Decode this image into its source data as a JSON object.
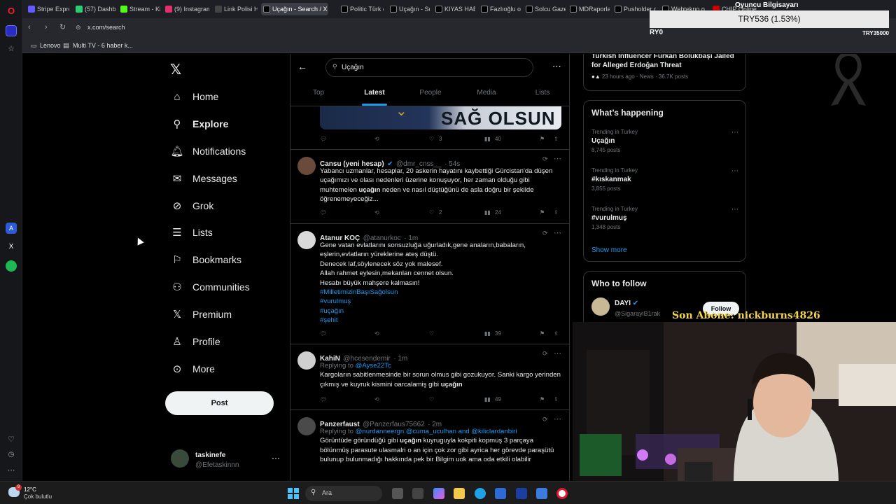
{
  "browser": {
    "tabs": [
      {
        "label": "Stripe Expres",
        "color": "#635bff"
      },
      {
        "label": "(57) Dashbo",
        "color": "#2ecc71"
      },
      {
        "label": "Stream - Kick",
        "color": "#53fc18"
      },
      {
        "label": "(9) Instagram",
        "color": "#e1306c"
      },
      {
        "label": "Link Polisi H",
        "color": "#444"
      },
      {
        "label": "Uçağın - Search / X",
        "color": "#000"
      },
      {
        "label": "Politic Türk o",
        "color": "#000"
      },
      {
        "label": "Uçağın - Sea",
        "color": "#000"
      },
      {
        "label": "KIYAS HABER",
        "color": "#000"
      },
      {
        "label": "Fazlıoğlu on",
        "color": "#000"
      },
      {
        "label": "Solcu Gazete",
        "color": "#000"
      },
      {
        "label": "MDRaporlar",
        "color": "#000"
      },
      {
        "label": "Pusholder o",
        "color": "#000"
      },
      {
        "label": "Webtekno o",
        "color": "#000"
      },
      {
        "label": "CHIP Online",
        "color": "#c00"
      }
    ],
    "url": "x.com/search",
    "bookmarks": [
      "Lenovo",
      "Multi TV - 6 haber k..."
    ]
  },
  "overlay": {
    "stream_title": "Oyuncu Bilgisayarı",
    "donation": "TRY536 (1.53%)",
    "left_amount": "RY0",
    "right_amount": "TRY35000",
    "last_sub": "Son Abone: nickburns4826"
  },
  "sidebar": {
    "items": [
      {
        "label": "Home",
        "icon": "home-icon"
      },
      {
        "label": "Explore",
        "icon": "search-icon"
      },
      {
        "label": "Notifications",
        "icon": "bell-icon"
      },
      {
        "label": "Messages",
        "icon": "mail-icon"
      },
      {
        "label": "Grok",
        "icon": "grok-icon"
      },
      {
        "label": "Lists",
        "icon": "list-icon"
      },
      {
        "label": "Bookmarks",
        "icon": "bookmark-icon"
      },
      {
        "label": "Communities",
        "icon": "people-icon"
      },
      {
        "label": "Premium",
        "icon": "x-logo-icon"
      },
      {
        "label": "Profile",
        "icon": "person-icon"
      },
      {
        "label": "More",
        "icon": "more-circle-icon"
      }
    ],
    "post_label": "Post",
    "account": {
      "name": "taskinefe",
      "handle": "@Efetaskinnn"
    }
  },
  "search": {
    "query": "Uçağın",
    "tabs": [
      "Top",
      "Latest",
      "People",
      "Media",
      "Lists"
    ],
    "active_tab": "Latest"
  },
  "tweets": [
    {
      "banner_text": "SAĞ OLSUN",
      "likes": "3",
      "views": "40"
    },
    {
      "name": "Cansu (yeni hesap)",
      "handle": "@dmr_cnss__",
      "time": "· 54s",
      "verified": true,
      "text_a": "Yabancı uzmanlar, hesaplar, 20 askerin hayatını kaybettiği Gürcistan'da düşen uçağımızı ve olası nedenleri üzerine konuşuyor, her zaman olduğu gibi muhtemelen ",
      "highlight": "uçağın",
      "text_b": " neden ve nasıl düştüğünü de asla doğru bir şekilde öğrenemeyeceğiz...",
      "likes": "2",
      "views": "24"
    },
    {
      "name": "Atanur KOÇ",
      "handle": "@atanurkoc",
      "time": "· 1m",
      "lines": [
        "Gene vatan evlatlarını sonsuzluğa uğurladık,gene anaların,babaların,",
        "eşlerin,evlatların yüreklerine ateş düştü.",
        "Denecek laf,söylenecek söz yok malesef.",
        "Allah rahmet eylesin,mekanları cennet olsun.",
        "Hesabı büyük mahşere kalmasın!"
      ],
      "hashtags": [
        "#MilletimizinBaşıSağolsun",
        "#vurulmuş",
        "#uçağın",
        "#şehit"
      ],
      "views": "39"
    },
    {
      "name": "KahiN",
      "handle": "@hcesendemir",
      "time": "· 1m",
      "replying_label": "Replying to",
      "replying_to": "@Ayse22Tc",
      "text_a": "Kargoların sabitlenmesinde bir sorun olmus gibi gozukuyor. Sanki kargo yerinden çıkmış ve kuyruk kismini oarcalamiş gibi ",
      "highlight": "uçağın",
      "views": "49"
    },
    {
      "name": "Panzerfaust",
      "handle": "@Panzerfaus75662",
      "time": "· 2m",
      "replying_label": "Replying to",
      "replying_to": "@nurdanneergn @cuma_uculhan and @kiliclardanbiri",
      "text_a": "Görüntüde göründüğü gibi ",
      "highlight": "uçağın",
      "text_b": " kuyruguyla kokpiti kopmuş 3 parçaya bölünmüş parasute ulasmalri o an için çok zor gibi ayrica her görevde paraşütü bulunup bulunmadığı hakkında pek bir Bilgim uok ama oda etkili olabilir"
    }
  ],
  "right": {
    "news_title": "Turkish Influencer Furkan Bolukbaşı Jailed for Alleged Erdoğan Threat",
    "news_meta": "23 hours ago · News · 36.7K posts",
    "happening_title": "What’s happening",
    "trends": [
      {
        "category": "Trending in Turkey",
        "name": "Uçağın",
        "count": "8,745 posts"
      },
      {
        "category": "Trending in Turkey",
        "name": "#kıskanmak",
        "count": "3,855 posts"
      },
      {
        "category": "Trending in Turkey",
        "name": "#vurulmuş",
        "count": "1,348 posts"
      }
    ],
    "show_more": "Show more",
    "who_title": "Who to follow",
    "follow": {
      "name": "DAYI",
      "handle": "@SigarayiB1rak",
      "button": "Follow"
    }
  },
  "taskbar": {
    "temp": "12°C",
    "weather": "Çok bulutlu",
    "search_placeholder": "Ara",
    "weather_badge": "9"
  },
  "colors": {
    "accent": "#1d9bf0",
    "opera": "#ff1b2d"
  }
}
